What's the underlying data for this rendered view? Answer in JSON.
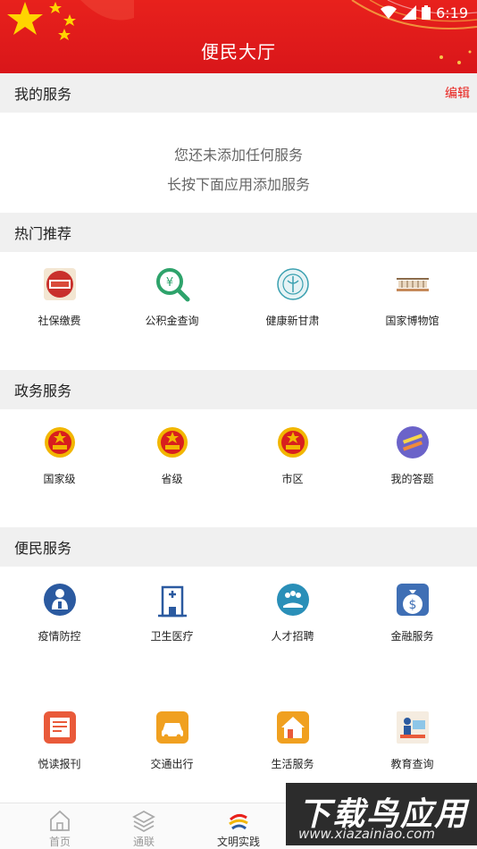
{
  "status_bar": {
    "time": "6:19"
  },
  "header": {
    "title": "便民大厅"
  },
  "my_services": {
    "title": "我的服务",
    "edit_label": "编辑",
    "empty_line1": "您还未添加任何服务",
    "empty_line2": "长按下面应用添加服务"
  },
  "hot": {
    "title": "热门推荐",
    "items": [
      {
        "label": "社保缴费",
        "icon": "social-security-icon"
      },
      {
        "label": "公积金查询",
        "icon": "fund-search-icon"
      },
      {
        "label": "健康新甘肃",
        "icon": "health-gansu-icon"
      },
      {
        "label": "国家博物馆",
        "icon": "national-museum-icon"
      }
    ]
  },
  "gov": {
    "title": "政务服务",
    "items": [
      {
        "label": "国家级",
        "icon": "national-emblem-icon"
      },
      {
        "label": "省级",
        "icon": "national-emblem-icon"
      },
      {
        "label": "市区",
        "icon": "national-emblem-icon"
      },
      {
        "label": "我的答题",
        "icon": "quiz-icon"
      }
    ]
  },
  "people": {
    "title": "便民服务",
    "items": [
      {
        "label": "疫情防控",
        "icon": "epidemic-control-icon"
      },
      {
        "label": "卫生医疗",
        "icon": "hospital-icon"
      },
      {
        "label": "人才招聘",
        "icon": "recruitment-icon"
      },
      {
        "label": "金融服务",
        "icon": "money-bag-icon"
      },
      {
        "label": "悦读报刊",
        "icon": "newspaper-icon"
      },
      {
        "label": "交通出行",
        "icon": "car-icon"
      },
      {
        "label": "生活服务",
        "icon": "home-icon"
      },
      {
        "label": "教育查询",
        "icon": "education-icon"
      }
    ]
  },
  "tabbar": {
    "items": [
      {
        "label": "首页",
        "icon": "home-tab-icon"
      },
      {
        "label": "通联",
        "icon": "layers-icon"
      },
      {
        "label": "文明实践",
        "icon": "civilization-icon"
      },
      {
        "label": "",
        "icon": ""
      }
    ]
  },
  "watermark": {
    "title": "下载鸟应用",
    "url": "www.xiazainiao.com"
  },
  "colors": {
    "brand_red": "#e8211c",
    "section_bg": "#f0f0f0"
  }
}
